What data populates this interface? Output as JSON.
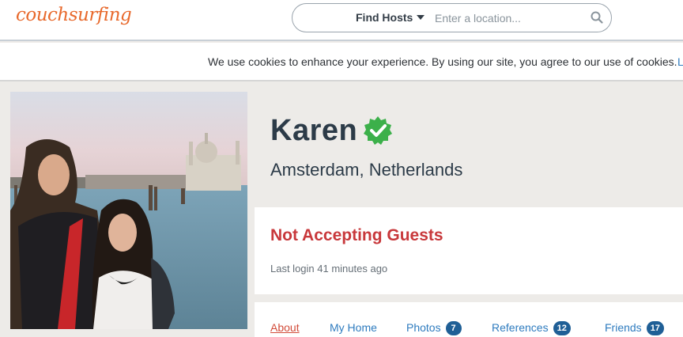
{
  "header": {
    "logo_text": "couchsurfing",
    "search_mode": "Find Hosts",
    "search_placeholder": "Enter a location...",
    "search_value": ""
  },
  "cookie_banner": {
    "text": "We use cookies to enhance your experience. By using our site, you agree to our use of cookies.",
    "link_text": "L"
  },
  "profile": {
    "name": "Karen",
    "location": "Amsterdam, Netherlands",
    "status": "Not Accepting Guests",
    "last_login": "Last login 41 minutes ago",
    "verified_icon": "verified-badge-icon"
  },
  "tabs": [
    {
      "label": "About",
      "active": true
    },
    {
      "label": "My Home"
    },
    {
      "label": "Photos",
      "count": "7"
    },
    {
      "label": "References",
      "count": "12"
    },
    {
      "label": "Friends",
      "count": "17"
    }
  ],
  "colors": {
    "brand": "#e8692c",
    "accent_link": "#2f7cbf",
    "status_red": "#c8383b",
    "badge": "#1f5f96",
    "verified": "#3cb04a"
  }
}
